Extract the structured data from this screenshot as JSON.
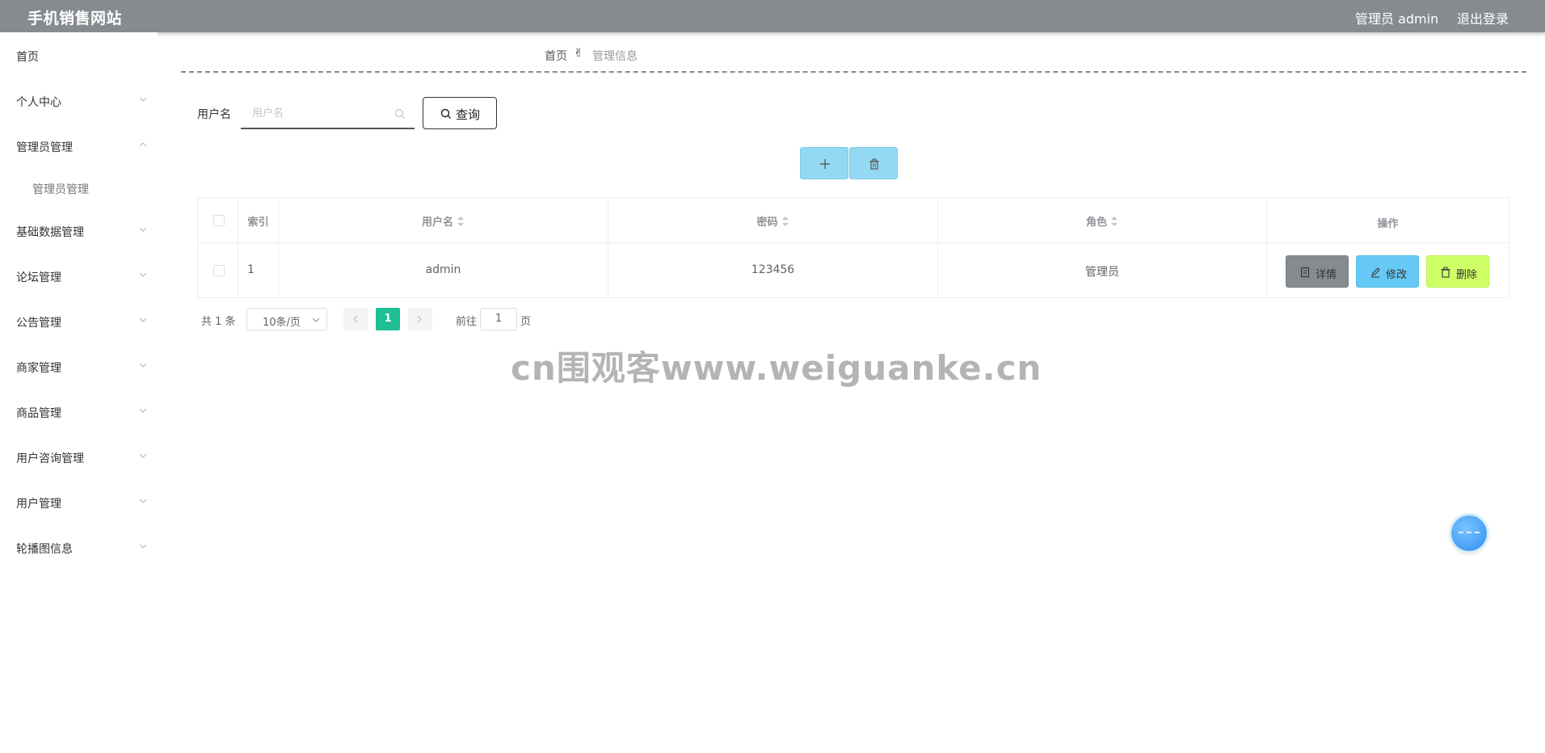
{
  "header": {
    "title": "手机销售网站",
    "user_label": "管理员 admin",
    "logout_label": "退出登录",
    "background_color": "#868b8f"
  },
  "sidebar": {
    "items": [
      {
        "label": "首页",
        "expandable": false
      },
      {
        "label": "个人中心",
        "expandable": true,
        "expanded": false
      },
      {
        "label": "管理员管理",
        "expandable": true,
        "expanded": true
      },
      {
        "label": "管理员管理",
        "sub": true
      },
      {
        "label": "基础数据管理",
        "expandable": true,
        "expanded": false
      },
      {
        "label": "论坛管理",
        "expandable": true,
        "expanded": false
      },
      {
        "label": "公告管理",
        "expandable": true,
        "expanded": false
      },
      {
        "label": "商家管理",
        "expandable": true,
        "expanded": false
      },
      {
        "label": "商品管理",
        "expandable": true,
        "expanded": false
      },
      {
        "label": "用户咨询管理",
        "expandable": true,
        "expanded": false
      },
      {
        "label": "用户管理",
        "expandable": true,
        "expanded": false
      },
      {
        "label": "轮播图信息",
        "expandable": true,
        "expanded": false
      }
    ]
  },
  "breadcrumb": {
    "home": "首页",
    "separator_icon": "hand-pointer-icon",
    "current": "管理信息"
  },
  "search": {
    "label": "用户名",
    "placeholder": "用户名",
    "value": "",
    "query_label": "查询"
  },
  "toolbar": {
    "add_icon": "plus-icon",
    "delete_icon": "trash-icon",
    "button_color": "#93d9f2"
  },
  "table": {
    "columns": [
      "索引",
      "用户名",
      "密码",
      "角色",
      "操作"
    ],
    "rows": [
      {
        "index": "1",
        "username": "admin",
        "password": "123456",
        "role": "管理员"
      }
    ],
    "actions": {
      "detail_label": "详情",
      "detail_color": "#868b8f",
      "edit_label": "修改",
      "edit_color": "#66c9f5",
      "delete_label": "删除",
      "delete_color": "#cfff66"
    }
  },
  "pagination": {
    "total_text": "共 1 条",
    "page_size": "10条/页",
    "current_page": "1",
    "goto_label": "前往",
    "goto_value": "1",
    "page_suffix": "页",
    "active_color": "#1fbf95"
  },
  "watermark": "cn围观客www.weiguanke.cn"
}
